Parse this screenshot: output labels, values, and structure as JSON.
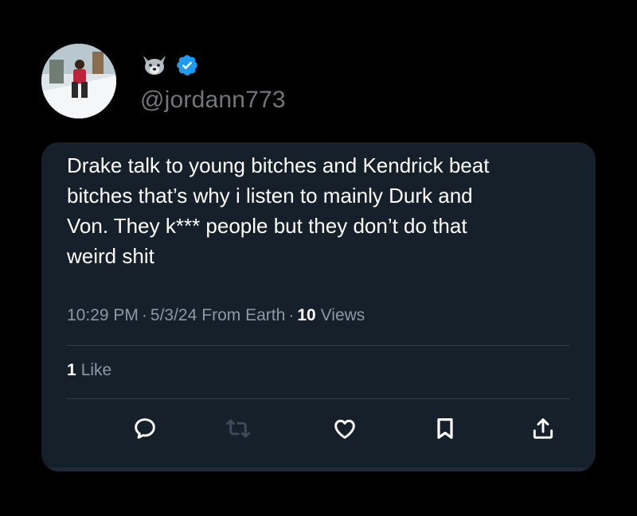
{
  "user": {
    "handle": "@jordann773",
    "emoji_icon": "wolf-face-icon",
    "verified_icon": "verified-badge-icon",
    "verified_color": "#1d9bf0"
  },
  "tweet": {
    "text": "Drake talk to young bitches and Kendrick beat\nbitches that’s why i listen to mainly Durk and\nVon. They k*** people but they don’t do that\nweird shit",
    "time": "10:29 PM",
    "separator": "·",
    "date": "5/3/24",
    "source": "From Earth",
    "views_count": "10",
    "views_label": "Views",
    "likes_count": "1",
    "likes_label": "Like"
  },
  "actions": [
    "reply-icon",
    "retweet-icon",
    "like-icon",
    "bookmark-icon",
    "share-icon"
  ],
  "colors": {
    "background": "#000000",
    "card": "#15202b",
    "primary_text": "#ffffff",
    "secondary_text": "#8b98a5"
  }
}
